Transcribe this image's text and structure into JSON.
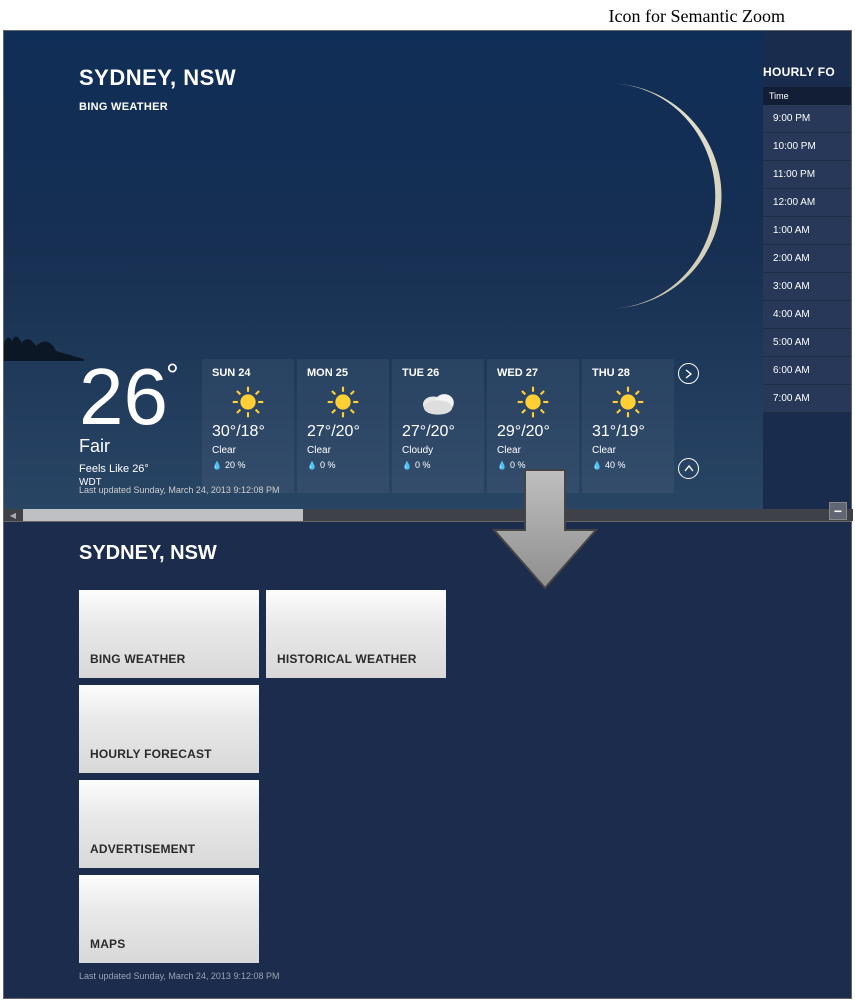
{
  "caption": "Icon for Semantic Zoom",
  "top": {
    "city": "SYDNEY, NSW",
    "app": "BING WEATHER",
    "current": {
      "temp": "26",
      "condition": "Fair",
      "feels": "Feels Like 26°",
      "tz": "WDT"
    },
    "forecast": [
      {
        "day": "SUN 24",
        "icon": "sun",
        "range": "30°/18°",
        "cond": "Clear",
        "precip": "20 %"
      },
      {
        "day": "MON 25",
        "icon": "sun",
        "range": "27°/20°",
        "cond": "Clear",
        "precip": "0 %"
      },
      {
        "day": "TUE 26",
        "icon": "cloud",
        "range": "27°/20°",
        "cond": "Cloudy",
        "precip": "0 %"
      },
      {
        "day": "WED 27",
        "icon": "sun",
        "range": "29°/20°",
        "cond": "Clear",
        "precip": "0 %"
      },
      {
        "day": "THU 28",
        "icon": "sun",
        "range": "31°/19°",
        "cond": "Clear",
        "precip": "40 %"
      }
    ],
    "last_updated": "Last updated Sunday, March 24, 2013 9:12:08 PM",
    "hourly": {
      "title": "HOURLY FO",
      "header": "Time",
      "rows": [
        "9:00 PM",
        "10:00 PM",
        "11:00 PM",
        "12:00 AM",
        "1:00 AM",
        "2:00 AM",
        "3:00 AM",
        "4:00 AM",
        "5:00 AM",
        "6:00 AM",
        "7:00 AM"
      ]
    },
    "zoom_icon": "−"
  },
  "bottom": {
    "city": "SYDNEY, NSW",
    "tiles": [
      [
        "BING WEATHER",
        "HISTORICAL WEATHER"
      ],
      [
        "HOURLY FORECAST"
      ],
      [
        "ADVERTISEMENT"
      ],
      [
        "MAPS"
      ]
    ],
    "last_updated": "Last updated Sunday, March 24, 2013 9:12:08 PM"
  }
}
